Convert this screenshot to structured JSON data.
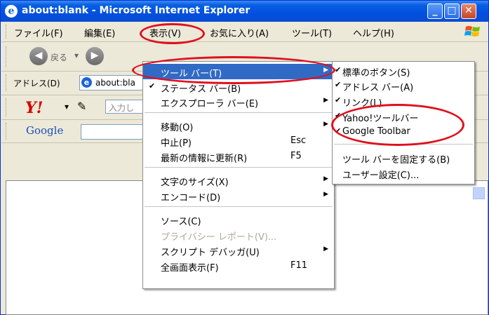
{
  "window": {
    "title": "about:blank - Microsoft Internet Explorer",
    "icon": "ie-e-icon",
    "controls": [
      "minimize",
      "maximize",
      "close"
    ]
  },
  "menubar": {
    "items": [
      "ファイル(F)",
      "編集(E)",
      "表示(V)",
      "お気に入り(A)",
      "ツール(T)",
      "ヘルプ(H)"
    ]
  },
  "nav": {
    "back_label": "戻る",
    "back_dropdown": "▾"
  },
  "address": {
    "label": "アドレス(D)",
    "value": "about:bla"
  },
  "yahoo": {
    "logo": "Y!",
    "search_placeholder": "入力し"
  },
  "google": {
    "logo": "Google"
  },
  "view_menu": {
    "items": [
      {
        "label": "ツール バー(T)",
        "submenu": true,
        "highlighted": true
      },
      {
        "label": "ステータス バー(B)",
        "checked": true
      },
      {
        "label": "エクスプローラ バー(E)",
        "submenu": true
      },
      {
        "label": "移動(O)",
        "submenu": true
      },
      {
        "label": "中止(P)",
        "shortcut": "Esc"
      },
      {
        "label": "最新の情報に更新(R)",
        "shortcut": "F5"
      },
      {
        "label": "文字のサイズ(X)",
        "submenu": true
      },
      {
        "label": "エンコード(D)",
        "submenu": true
      },
      {
        "label": "ソース(C)"
      },
      {
        "label": "プライバシー レポート(V)...",
        "disabled": true
      },
      {
        "label": "スクリプト デバッガ(U)",
        "submenu": true
      },
      {
        "label": "全画面表示(F)",
        "shortcut": "F11"
      }
    ]
  },
  "toolbar_submenu": {
    "items": [
      {
        "label": "標準のボタン(S)",
        "checked": true
      },
      {
        "label": "アドレス バー(A)",
        "checked": true
      },
      {
        "label": "リンク(L)",
        "checked": true
      },
      {
        "label": "Yahoo!ツールバー",
        "checked": true
      },
      {
        "label": "Google Toolbar",
        "checked": true
      },
      {
        "label": "ツール バーを固定する(B)"
      },
      {
        "label": "ユーザー設定(C)..."
      }
    ]
  },
  "colors": {
    "highlight": "#316AC5",
    "annotation": "#E0101E",
    "titlebar": "#0A5FE0"
  }
}
